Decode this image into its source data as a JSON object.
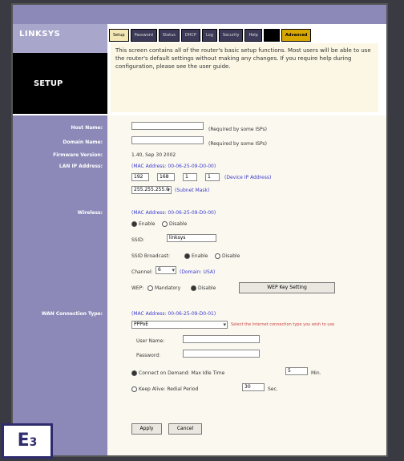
{
  "brand": "LINKSYS",
  "page_title": "SETUP",
  "tabs": [
    {
      "label": "Setup",
      "active": true
    },
    {
      "label": "Password"
    },
    {
      "label": "Status"
    },
    {
      "label": "DHCP"
    },
    {
      "label": "Log"
    },
    {
      "label": "Security"
    },
    {
      "label": "Help"
    },
    {
      "label": ""
    },
    {
      "label": "Advanced"
    }
  ],
  "description": "This screen contains all of the router's basic setup functions. Most users will be able to use the router's default settings without making any changes. If you require help during configuration, please see the user guide.",
  "fields": {
    "host_name": {
      "label": "Host Name:",
      "value": "",
      "hint": "(Required by some ISPs)"
    },
    "domain_name": {
      "label": "Domain Name:",
      "value": "",
      "hint": "(Required by some ISPs)"
    },
    "firmware": {
      "label": "Firmware Version:",
      "value": "1.40, Sep 30 2002"
    },
    "lan_ip": {
      "label": "LAN IP Address:",
      "mac": "(MAC Address: 00-06-25-09-D0-00)",
      "octets": [
        "192",
        "168",
        "1",
        "1"
      ],
      "hint": "(Device IP Address)",
      "mask": "255.255.255.0",
      "mask_hint": "(Subnet Mask)"
    },
    "wireless": {
      "label": "Wireless:",
      "mac": "(MAC Address: 00-06-25-09-D0-00)",
      "enable": "Enable",
      "disable": "Disable",
      "ssid_label": "SSID:",
      "ssid": "linksys",
      "broadcast_label": "SSID Broadcast:",
      "channel_label": "Channel:",
      "channel": "6",
      "domain": "(Domain: USA)",
      "wep_label": "WEP:",
      "mandatory": "Mandatory",
      "wep_disable": "Disable",
      "wep_button": "WEP Key Setting"
    },
    "wan": {
      "label": "WAN Connection Type:",
      "mac": "(MAC Address: 00-06-25-09-D0-01)",
      "type": "PPPoE",
      "type_hint": "Select the Internet connection type you wish to use",
      "user_label": "User Name:",
      "pass_label": "Password:",
      "connect_demand": "Connect on Demand: Max Idle Time",
      "idle_value": "5",
      "min": "Min.",
      "keep_alive": "Keep Alive: Redial Period",
      "redial_value": "30",
      "sec": "Sec."
    }
  },
  "buttons": {
    "apply": "Apply",
    "cancel": "Cancel"
  },
  "badge": {
    "letter": "E",
    "num": "3"
  }
}
